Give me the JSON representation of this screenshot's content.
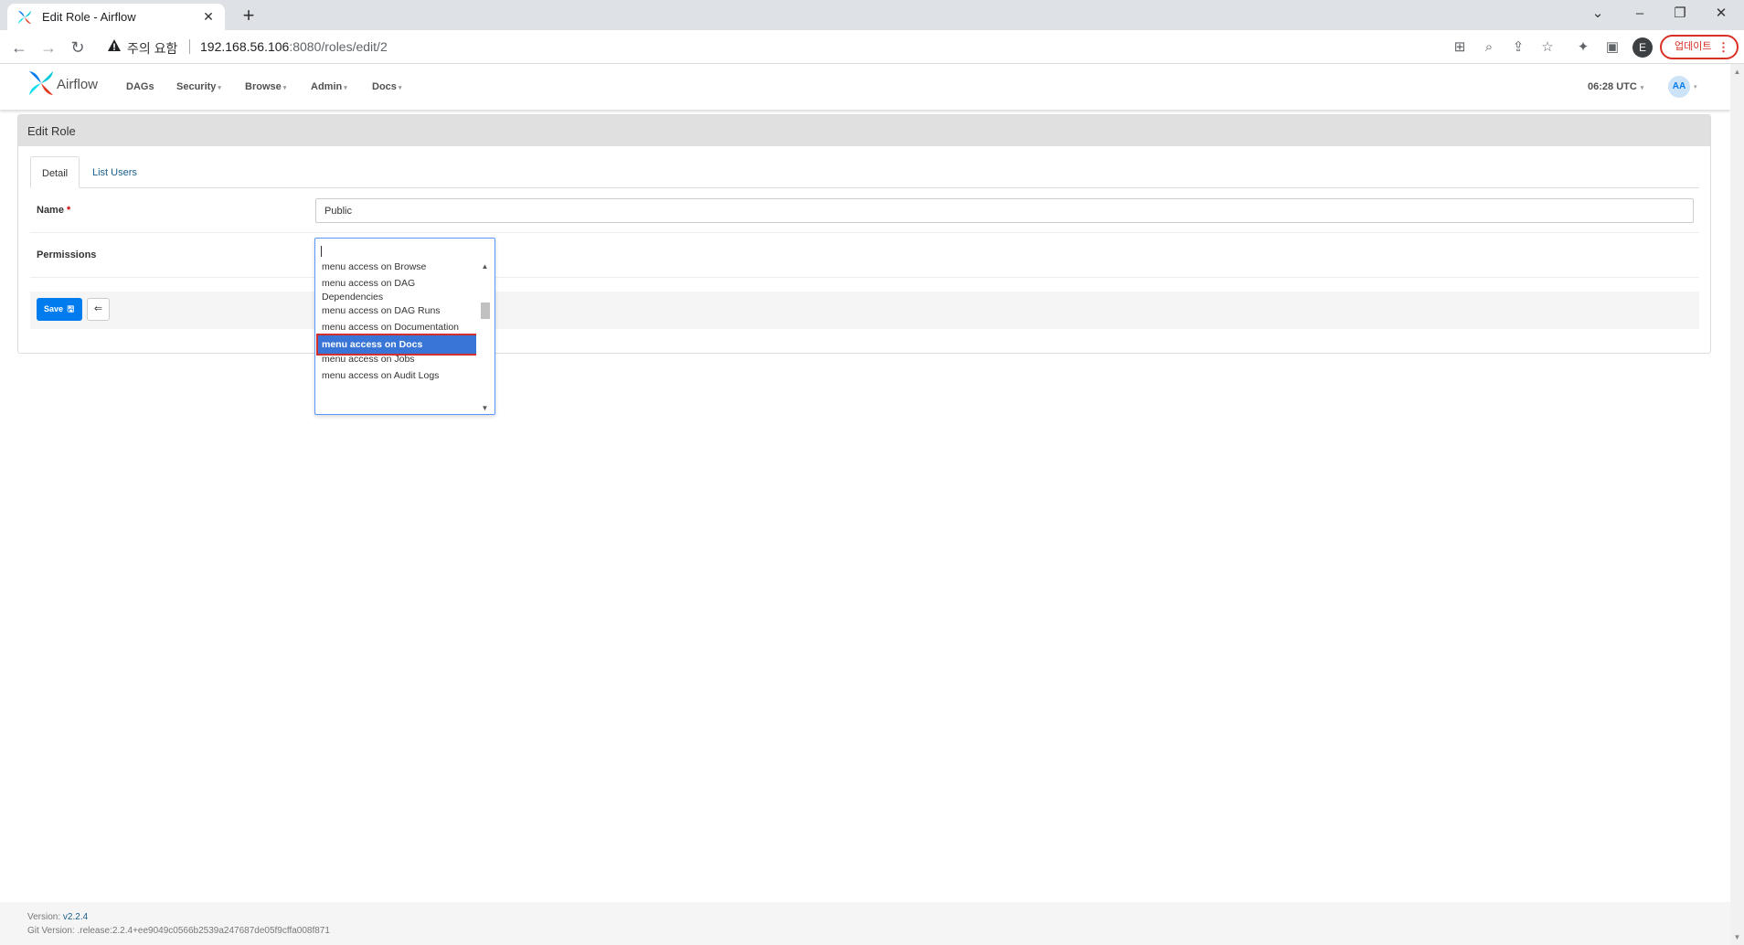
{
  "browser": {
    "tab_title": "Edit Role - Airflow",
    "new_tab": "+",
    "security_warning": "주의 요함",
    "url_host": "192.168.56.106",
    "url_rest": ":8080/roles/edit/2",
    "profile_initial": "E",
    "update_label": "업데이트",
    "update_menu": "⋮"
  },
  "airflow": {
    "brand": "Airflow",
    "menu": [
      "DAGs",
      "Security",
      "Browse",
      "Admin",
      "Docs"
    ],
    "time": "06:28 UTC",
    "avatar": "AA"
  },
  "form": {
    "heading": "Edit Role",
    "tabs": [
      "Detail",
      "List Users"
    ],
    "name_label": "Name",
    "required_mark": "*",
    "name_value": "Public",
    "permissions_label": "Permissions",
    "save_label": "Save",
    "back_icon": "⇐"
  },
  "permissions_dropdown": {
    "items": [
      "menu access on Browse",
      "menu access on DAG Dependencies",
      "menu access on DAG Runs",
      "menu access on Documentation",
      "menu access on Docs",
      "menu access on Jobs",
      "menu access on Audit Logs"
    ],
    "highlighted": "menu access on Docs"
  },
  "footer": {
    "version_label": "Version: ",
    "version": "v2.2.4",
    "git_label": "Git Version: ",
    "git": ".release:2.2.4+ee9049c0566b2539a247687de05f9cffa008f871"
  },
  "colors": {
    "airflow_blue": "#017cee",
    "highlight_bg": "#3875d7",
    "highlight_border": "#d32f2f",
    "update_red": "#d93025"
  }
}
